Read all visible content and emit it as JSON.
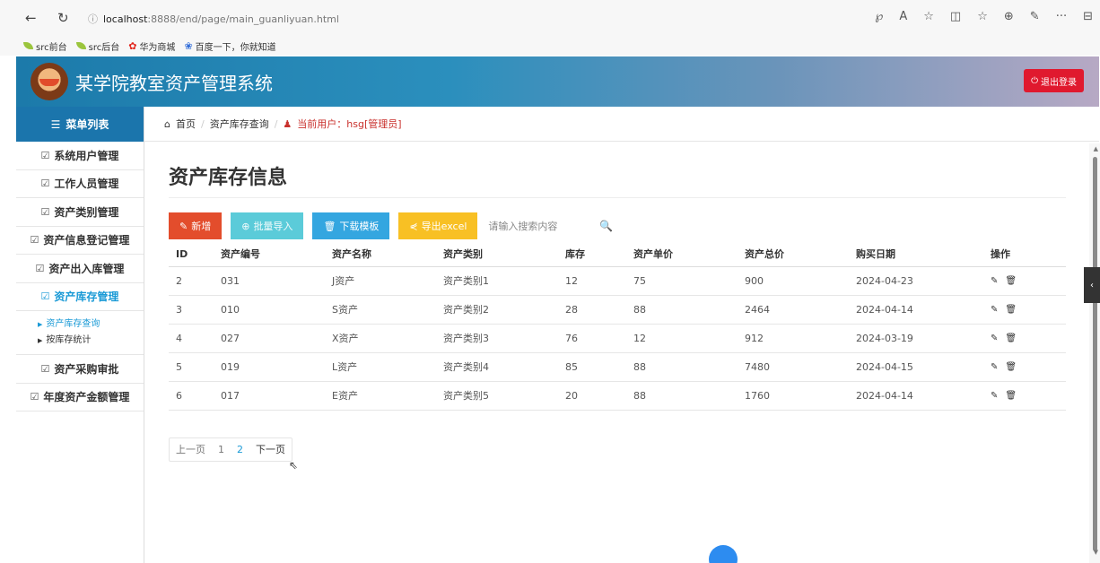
{
  "browser": {
    "back": "←",
    "reload": "↻",
    "info": "ⓘ",
    "url_host": "localhost",
    "url_path": ":8888/end/page/main_guanliyuan.html",
    "toolbar_icons": [
      "℘",
      "A",
      "☆",
      "◫",
      "☆",
      "⊕",
      "✎",
      "···",
      "⊟"
    ],
    "bookmarks": [
      "src前台",
      "src后台",
      "华为商城",
      "百度一下，你就知道"
    ]
  },
  "header": {
    "title": "某学院教室资产管理系统",
    "logout_label": "退出登录"
  },
  "sidebar": {
    "title": "菜单列表",
    "items": [
      {
        "label": "系统用户管理"
      },
      {
        "label": "工作人员管理"
      },
      {
        "label": "资产类别管理"
      },
      {
        "label": "资产信息登记管理"
      },
      {
        "label": "资产出入库管理"
      },
      {
        "label": "资产库存管理"
      }
    ],
    "subitems": [
      {
        "label": "资产库存查询"
      },
      {
        "label": "按库存统计"
      }
    ],
    "items_after": [
      {
        "label": "资产采购审批"
      },
      {
        "label": "年度资产金额管理"
      }
    ]
  },
  "breadcrumb": {
    "home": "首页",
    "current": "资产库存查询",
    "user": "当前用户：hsg[管理员]"
  },
  "main": {
    "title": "资产库存信息",
    "buttons": {
      "add": "新增",
      "import": "批量导入",
      "template": "下载模板",
      "export": "导出excel"
    },
    "search_placeholder": "请输入搜索内容",
    "columns": [
      "ID",
      "资产编号",
      "资产名称",
      "资产类别",
      "库存",
      "资产单价",
      "资产总价",
      "购买日期",
      "操作"
    ],
    "rows": [
      [
        "2",
        "031",
        "J资产",
        "资产类别1",
        "12",
        "75",
        "900",
        "2024-04-23"
      ],
      [
        "3",
        "010",
        "S资产",
        "资产类别2",
        "28",
        "88",
        "2464",
        "2024-04-14"
      ],
      [
        "4",
        "027",
        "X资产",
        "资产类别3",
        "76",
        "12",
        "912",
        "2024-03-19"
      ],
      [
        "5",
        "019",
        "L资产",
        "资产类别4",
        "85",
        "88",
        "7480",
        "2024-04-15"
      ],
      [
        "6",
        "017",
        "E资产",
        "资产类别5",
        "20",
        "88",
        "1760",
        "2024-04-14"
      ]
    ],
    "pager": {
      "prev": "上一页",
      "pages": [
        "1",
        "2"
      ],
      "next": "下一页"
    }
  }
}
